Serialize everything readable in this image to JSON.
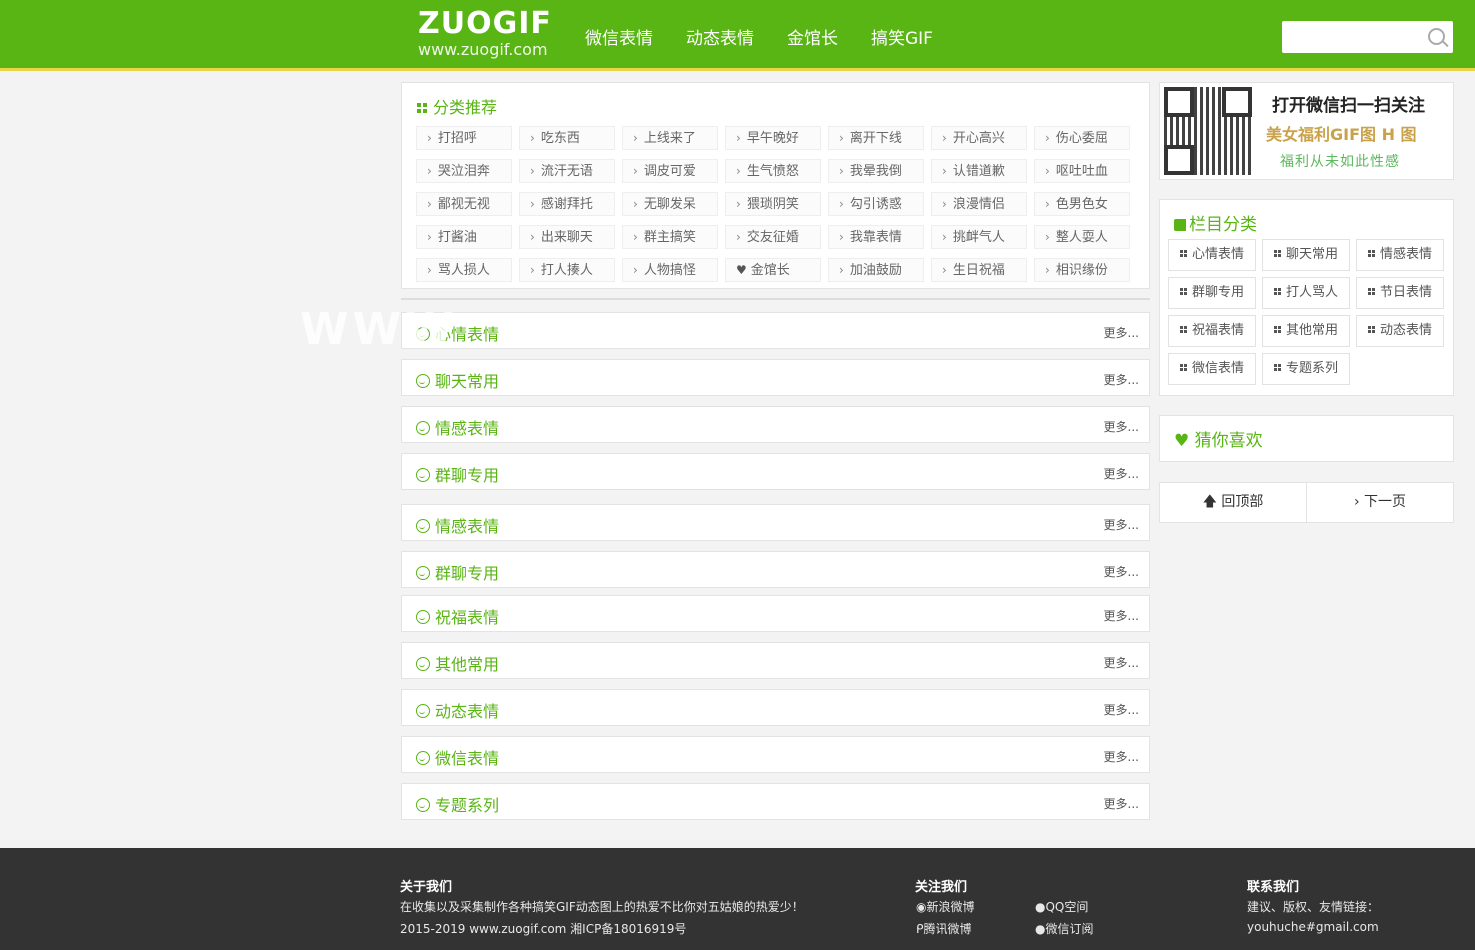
{
  "header": {
    "logo_main": "ZUOGIF",
    "logo_sub": "www.zuogif.com",
    "nav": [
      "微信表情",
      "动态表情",
      "金馆长",
      "搞笑GIF"
    ],
    "search_placeholder": ""
  },
  "categories": {
    "title": "分类推荐",
    "tags": [
      "打招呼",
      "吃东西",
      "上线来了",
      "早午晚好",
      "离开下线",
      "开心高兴",
      "伤心委屈",
      "哭泣泪奔",
      "流汗无语",
      "调皮可爱",
      "生气愤怒",
      "我晕我倒",
      "认错道歉",
      "呕吐吐血",
      "鄙视无视",
      "感谢拜托",
      "无聊发呆",
      "猥琐阴笑",
      "勾引诱惑",
      "浪漫情侣",
      "色男色女",
      "打酱油",
      "出来聊天",
      "群主搞笑",
      "交友征婚",
      "我靠表情",
      "挑衅气人",
      "整人耍人",
      "骂人损人",
      "打人揍人",
      "人物搞怪",
      "金馆长",
      "加油鼓励",
      "生日祝福",
      "相识缘份"
    ],
    "heart_tag_index": 31
  },
  "sections": [
    {
      "title": "心情表情",
      "more": "更多..."
    },
    {
      "title": "聊天常用",
      "more": "更多..."
    },
    {
      "title": "情感表情",
      "more": "更多..."
    },
    {
      "title": "群聊专用",
      "more": "更多..."
    },
    {
      "title": "情感表情",
      "more": "更多..."
    },
    {
      "title": "群聊专用",
      "more": "更多..."
    },
    {
      "title": "祝福表情",
      "more": "更多..."
    },
    {
      "title": "其他常用",
      "more": "更多..."
    },
    {
      "title": "动态表情",
      "more": "更多..."
    },
    {
      "title": "微信表情",
      "more": "更多..."
    },
    {
      "title": "专题系列",
      "more": "更多..."
    }
  ],
  "watermark": "WWW",
  "sidebar": {
    "qr_line1": "打开微信扫一扫关注",
    "qr_line2": "美女福利GIF图 H 图",
    "qr_line3": "福利从未如此性感",
    "column_title": "栏目分类",
    "columns": [
      "心情表情",
      "聊天常用",
      "情感表情",
      "群聊专用",
      "打人骂人",
      "节日表情",
      "祝福表情",
      "其他常用",
      "动态表情",
      "微信表情",
      "专题系列"
    ],
    "guess_title": "猜你喜欢",
    "back_top": "回顶部",
    "next_page": "下一页"
  },
  "footer": {
    "about_title": "关于我们",
    "about_text": "在收集以及采集制作各种搞笑GIF动态图上的热爱不比你对五姑娘的热爱少！",
    "copyright": "2015-2019 www.zuogif.com 湘ICP备18016919号",
    "follow_title": "关注我们",
    "follow_links": [
      "新浪微博",
      "QQ空间",
      "腾讯微博",
      "微信订阅"
    ],
    "contact_title": "联系我们",
    "contact_text": "建议、版权、友情链接：",
    "contact_email": "youhuche#gmail.com"
  },
  "colors": {
    "brand": "#58b514",
    "footer_bg": "#333333"
  }
}
